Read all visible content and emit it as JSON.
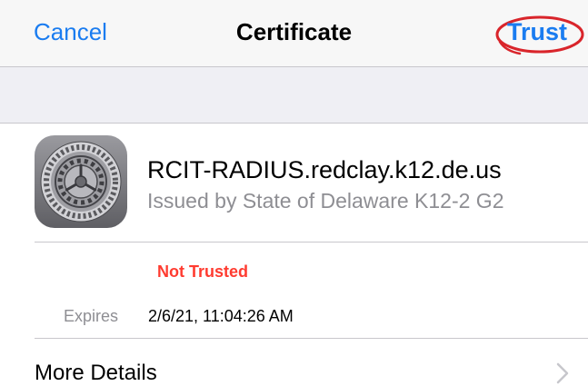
{
  "navbar": {
    "cancel_label": "Cancel",
    "title": "Certificate",
    "trust_label": "Trust"
  },
  "certificate": {
    "icon": "gear-icon",
    "name": "RCIT-RADIUS.redclay.k12.de.us",
    "issuer": "Issued by State of Delaware K12-2 G2",
    "status": "Not Trusted",
    "expires_label": "Expires",
    "expires_value": "2/6/21, 11:04:26 AM"
  },
  "more_details": {
    "label": "More Details",
    "icon": "chevron-right-icon"
  },
  "colors": {
    "accent": "#1a7cf0",
    "status_red": "#ff3b30",
    "annotation_red": "#d9252b",
    "secondary_text": "#8e8e93"
  }
}
